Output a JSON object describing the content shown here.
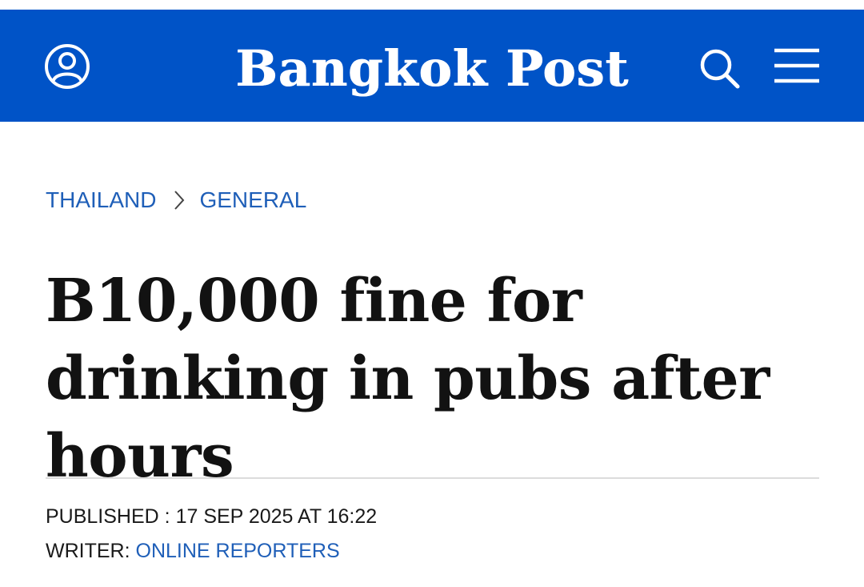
{
  "header": {
    "logo_text": "Bangkok Post",
    "background_color": "#0053c7",
    "icons": {
      "account": "user-account-icon",
      "search": "search-icon",
      "menu": "hamburger-menu-icon"
    }
  },
  "breadcrumb": {
    "items": [
      {
        "label": "THAILAND"
      },
      {
        "label": "GENERAL"
      }
    ],
    "separator_icon": "chevron-right-icon",
    "link_color": "#1f5fb8"
  },
  "article": {
    "headline": "B10,000 fine for drinking in pubs after hours",
    "published_label": "PUBLISHED :",
    "published_value": "17 SEP 2025 AT 16:22",
    "writer_label": "WRITER:",
    "writer_name": "ONLINE REPORTERS"
  }
}
